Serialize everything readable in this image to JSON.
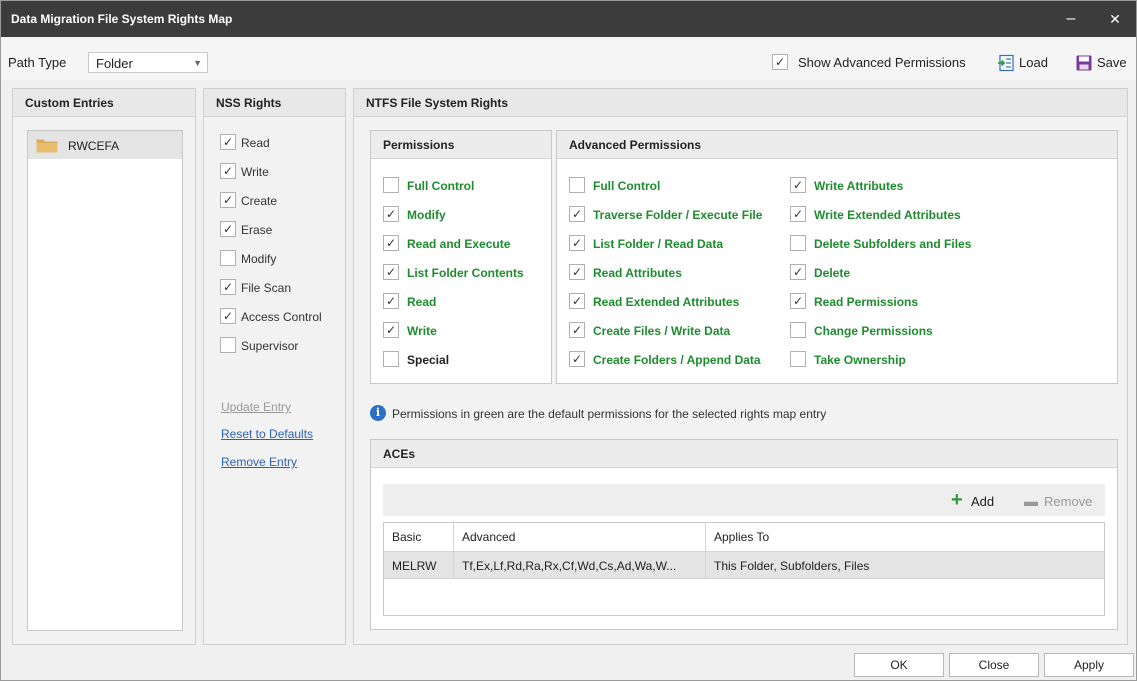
{
  "window": {
    "title": "Data Migration File System Rights Map",
    "minimize_glyph": "–",
    "close_glyph": "✕"
  },
  "toolbar": {
    "path_type_label": "Path Type",
    "path_type_value": "Folder",
    "show_advanced_label": "Show Advanced Permissions",
    "show_advanced_checked": true,
    "load_label": "Load",
    "save_label": "Save"
  },
  "custom_entries": {
    "header": "Custom Entries",
    "items": [
      {
        "label": "RWCEFA"
      }
    ]
  },
  "nss_rights": {
    "header": "NSS Rights",
    "items": [
      {
        "label": "Read",
        "checked": true
      },
      {
        "label": "Write",
        "checked": true
      },
      {
        "label": "Create",
        "checked": true
      },
      {
        "label": "Erase",
        "checked": true
      },
      {
        "label": "Modify",
        "checked": false
      },
      {
        "label": "File Scan",
        "checked": true
      },
      {
        "label": "Access Control",
        "checked": true
      },
      {
        "label": "Supervisor",
        "checked": false
      }
    ],
    "update_entry": "Update Entry",
    "reset_defaults": "Reset to Defaults",
    "remove_entry": "Remove Entry"
  },
  "ntfs": {
    "header": "NTFS File System Rights",
    "permissions": {
      "header": "Permissions",
      "items": [
        {
          "label": "Full Control",
          "checked": false,
          "default": true
        },
        {
          "label": "Modify",
          "checked": true,
          "default": true
        },
        {
          "label": "Read and Execute",
          "checked": true,
          "default": true
        },
        {
          "label": "List Folder Contents",
          "checked": true,
          "default": true
        },
        {
          "label": "Read",
          "checked": true,
          "default": true
        },
        {
          "label": "Write",
          "checked": true,
          "default": true
        },
        {
          "label": "Special",
          "checked": false,
          "default": false
        }
      ]
    },
    "advanced": {
      "header": "Advanced Permissions",
      "left": [
        {
          "label": "Full Control",
          "checked": false
        },
        {
          "label": "Traverse Folder / Execute File",
          "checked": true
        },
        {
          "label": "List Folder / Read Data",
          "checked": true
        },
        {
          "label": "Read Attributes",
          "checked": true
        },
        {
          "label": "Read Extended Attributes",
          "checked": true
        },
        {
          "label": "Create Files / Write Data",
          "checked": true
        },
        {
          "label": "Create Folders / Append Data",
          "checked": true
        }
      ],
      "right": [
        {
          "label": "Write Attributes",
          "checked": true
        },
        {
          "label": "Write Extended Attributes",
          "checked": true
        },
        {
          "label": "Delete Subfolders and Files",
          "checked": false
        },
        {
          "label": "Delete",
          "checked": true
        },
        {
          "label": "Read Permissions",
          "checked": true
        },
        {
          "label": "Change Permissions",
          "checked": false
        },
        {
          "label": "Take Ownership",
          "checked": false
        }
      ]
    },
    "info_text": "Permissions in green are the default permissions for the selected rights map entry",
    "aces": {
      "header": "ACEs",
      "add_label": "Add",
      "remove_label": "Remove",
      "columns": [
        "Basic",
        "Advanced",
        "Applies To"
      ],
      "rows": [
        [
          "MELRW",
          "Tf,Ex,Lf,Rd,Ra,Rx,Cf,Wd,Cs,Ad,Wa,W...",
          "This Folder, Subfolders, Files"
        ]
      ]
    }
  },
  "footer": {
    "ok": "OK",
    "close": "Close",
    "apply": "Apply"
  },
  "colors": {
    "titlebar": "#3c3c3c",
    "default_green": "#1e8c2e",
    "link_blue": "#2f5fb5",
    "info_blue": "#2d6fc4"
  },
  "icons": {
    "folder": "folder-icon",
    "load": "load-icon",
    "save": "save-icon",
    "info": "info-icon",
    "add": "plus-icon",
    "remove": "minus-icon"
  }
}
